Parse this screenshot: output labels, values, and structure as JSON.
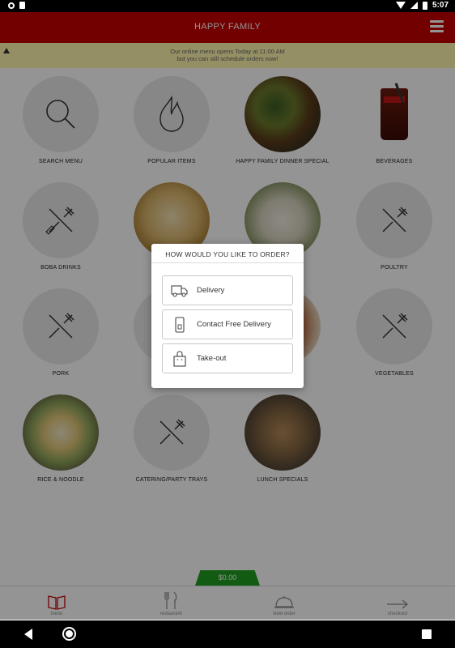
{
  "status_bar": {
    "time": "5:07"
  },
  "app_bar": {
    "title": "HAPPY FAMILY"
  },
  "notice": {
    "line1": "Our online menu opens Today at 11:00 AM",
    "line2": "but you can still schedule orders now!"
  },
  "menu": {
    "tiles": [
      {
        "label": "SEARCH MENU",
        "icon": "search-icon"
      },
      {
        "label": "POPULAR ITEMS",
        "icon": "flame-icon"
      },
      {
        "label": "HAPPY FAMILY DINNER SPECIAL",
        "icon": "food-photo"
      },
      {
        "label": "BEVERAGES",
        "icon": "drink-photo"
      },
      {
        "label": "BOBA DRINKS",
        "icon": "fork-knife-icon"
      },
      {
        "label": "",
        "icon": "food-photo"
      },
      {
        "label": "",
        "icon": "food-photo"
      },
      {
        "label": "POULTRY",
        "icon": "fork-knife-icon"
      },
      {
        "label": "PORK",
        "icon": "fork-knife-icon"
      },
      {
        "label": "",
        "icon": "food-photo"
      },
      {
        "label": "",
        "icon": "food-photo"
      },
      {
        "label": "VEGETABLES",
        "icon": "fork-knife-icon"
      },
      {
        "label": "RICE & NOODLE",
        "icon": "food-photo"
      },
      {
        "label": "CATERING/PARTY TRAYS",
        "icon": "fork-knife-icon"
      },
      {
        "label": "LUNCH SPECIALS",
        "icon": "food-photo"
      }
    ]
  },
  "modal": {
    "title": "HOW WOULD YOU LIKE TO ORDER?",
    "options": [
      {
        "label": "Delivery",
        "icon": "truck-icon"
      },
      {
        "label": "Contact Free Delivery",
        "icon": "phone-icon"
      },
      {
        "label": "Take-out",
        "icon": "bag-icon"
      }
    ]
  },
  "cart": {
    "total": "$0.00"
  },
  "bottom_nav": {
    "items": [
      {
        "label": "menu",
        "icon": "book-icon"
      },
      {
        "label": "restaurant",
        "icon": "utensils-icon"
      },
      {
        "label": "view order",
        "icon": "cloche-icon"
      },
      {
        "label": "checkout",
        "icon": "arrow-right-icon"
      }
    ]
  },
  "colors": {
    "brand": "#c40000",
    "notice_bg": "#fff7ad",
    "cart_total": "#1f9e1f"
  }
}
